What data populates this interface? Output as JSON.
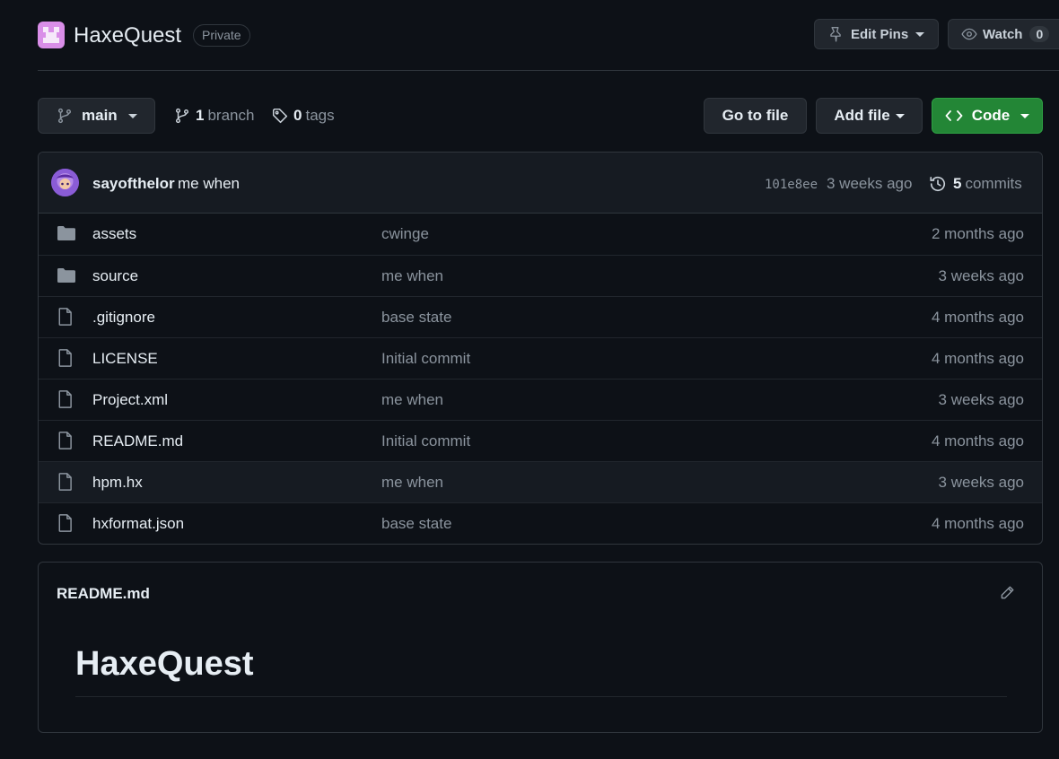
{
  "repo": {
    "name": "HaxeQuest",
    "visibility": "Private",
    "edit_pins_label": "Edit Pins",
    "watch_label": "Watch",
    "watch_count": "0"
  },
  "toolbar": {
    "branch_name": "main",
    "branch_count": "1",
    "branch_label": "branch",
    "tag_count": "0",
    "tag_label": "tags",
    "goto_file_label": "Go to file",
    "add_file_label": "Add file",
    "code_label": "Code"
  },
  "latest_commit": {
    "author": "sayofthelor",
    "message": "me when",
    "sha": "101e8ee",
    "time": "3 weeks ago",
    "commit_count": "5",
    "commit_label": "commits"
  },
  "files": [
    {
      "type": "folder",
      "name": "assets",
      "message": "cwinge",
      "time": "2 months ago"
    },
    {
      "type": "folder",
      "name": "source",
      "message": "me when",
      "time": "3 weeks ago"
    },
    {
      "type": "file",
      "name": ".gitignore",
      "message": "base state",
      "time": "4 months ago"
    },
    {
      "type": "file",
      "name": "LICENSE",
      "message": "Initial commit",
      "time": "4 months ago"
    },
    {
      "type": "file",
      "name": "Project.xml",
      "message": "me when",
      "time": "3 weeks ago"
    },
    {
      "type": "file",
      "name": "README.md",
      "message": "Initial commit",
      "time": "4 months ago"
    },
    {
      "type": "file",
      "name": "hpm.hx",
      "message": "me when",
      "time": "3 weeks ago"
    },
    {
      "type": "file",
      "name": "hxformat.json",
      "message": "base state",
      "time": "4 months ago"
    }
  ],
  "readme": {
    "filename": "README.md",
    "heading": "HaxeQuest"
  },
  "colors": {
    "background": "#0d1117",
    "border": "#30363d",
    "code_button": "#238636",
    "muted_text": "#8b949e"
  }
}
